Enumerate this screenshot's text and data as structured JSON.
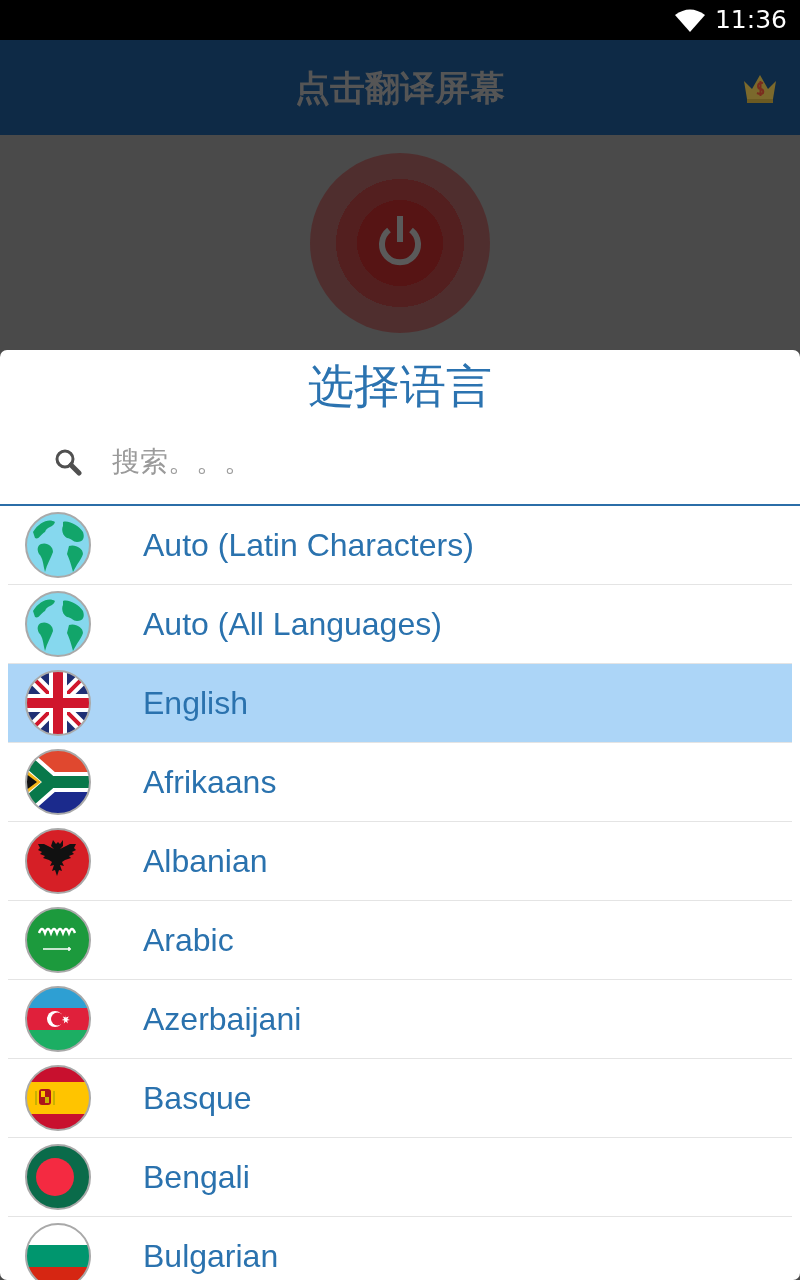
{
  "status_bar": {
    "time": "11:36"
  },
  "app_bar": {
    "title": "点击翻译屏幕"
  },
  "dialog": {
    "title": "选择语言",
    "search": {
      "placeholder": "搜索。。。"
    },
    "languages": [
      {
        "name": "Auto (Latin Characters)",
        "kind": "globe",
        "selected": false
      },
      {
        "name": "Auto (All Languages)",
        "kind": "globe",
        "selected": false
      },
      {
        "name": "English",
        "kind": "uk",
        "selected": true
      },
      {
        "name": "Afrikaans",
        "kind": "southafrica",
        "selected": false
      },
      {
        "name": "Albanian",
        "kind": "albania",
        "selected": false
      },
      {
        "name": "Arabic",
        "kind": "saudi",
        "selected": false
      },
      {
        "name": "Azerbaijani",
        "kind": "azerbaijan",
        "selected": false
      },
      {
        "name": "Basque",
        "kind": "spain",
        "selected": false
      },
      {
        "name": "Bengali",
        "kind": "bangladesh",
        "selected": false
      },
      {
        "name": "Bulgarian",
        "kind": "bulgaria",
        "selected": false
      }
    ]
  }
}
